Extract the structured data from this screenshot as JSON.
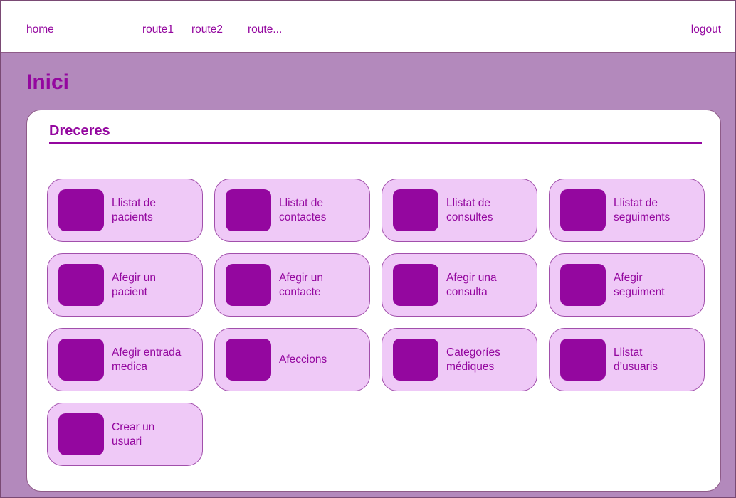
{
  "nav": {
    "home": "home",
    "route1": "route1",
    "route2": "route2",
    "route3": "route...",
    "logout": "logout"
  },
  "page": {
    "title": "Inici"
  },
  "shortcuts": {
    "title": "Dreceres",
    "items": [
      {
        "label": "Llistat de\npacients"
      },
      {
        "label": "Llistat de\ncontactes"
      },
      {
        "label": "Llistat de\nconsultes"
      },
      {
        "label": "Llistat de\nseguiments"
      },
      {
        "label": "Afegir un\npacient"
      },
      {
        "label": "Afegir un\ncontacte"
      },
      {
        "label": "Afegir una\nconsulta"
      },
      {
        "label": "Afegir\nseguiment"
      },
      {
        "label": "Afegir entrada\nmedica"
      },
      {
        "label": "Afeccions"
      },
      {
        "label": "Categoríes\nmédiques"
      },
      {
        "label": "Llistat\nd’usuaris"
      },
      {
        "label": "Crear un\nusuari"
      }
    ]
  },
  "colors": {
    "accent": "#94079f",
    "background": "#b389bc",
    "tile": "#efc9f7"
  }
}
